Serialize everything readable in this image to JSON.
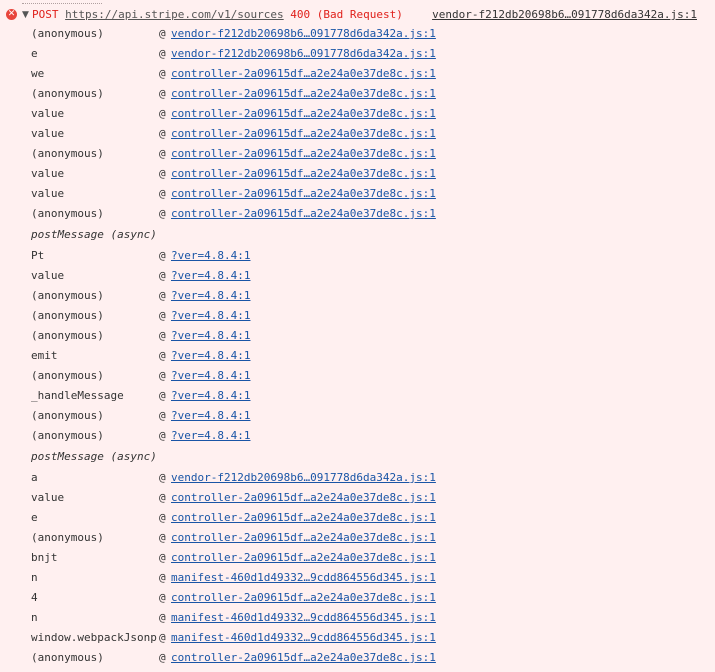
{
  "header": {
    "method": "POST",
    "url": "https://api.stripe.com/v1/sources",
    "status": "400 (Bad Request)",
    "source": "vendor-f212db20698b6…091778d6da342a.js:1"
  },
  "at_symbol": "@",
  "stack": [
    {
      "type": "frame",
      "fn": "(anonymous)",
      "src": "vendor-f212db20698b6…091778d6da342a.js:1"
    },
    {
      "type": "frame",
      "fn": "e",
      "src": "vendor-f212db20698b6…091778d6da342a.js:1"
    },
    {
      "type": "frame",
      "fn": "we",
      "src": "controller-2a09615df…a2e24a0e37de8c.js:1"
    },
    {
      "type": "frame",
      "fn": "(anonymous)",
      "src": "controller-2a09615df…a2e24a0e37de8c.js:1"
    },
    {
      "type": "frame",
      "fn": "value",
      "src": "controller-2a09615df…a2e24a0e37de8c.js:1"
    },
    {
      "type": "frame",
      "fn": "value",
      "src": "controller-2a09615df…a2e24a0e37de8c.js:1"
    },
    {
      "type": "frame",
      "fn": "(anonymous)",
      "src": "controller-2a09615df…a2e24a0e37de8c.js:1"
    },
    {
      "type": "frame",
      "fn": "value",
      "src": "controller-2a09615df…a2e24a0e37de8c.js:1"
    },
    {
      "type": "frame",
      "fn": "value",
      "src": "controller-2a09615df…a2e24a0e37de8c.js:1"
    },
    {
      "type": "frame",
      "fn": "(anonymous)",
      "src": "controller-2a09615df…a2e24a0e37de8c.js:1"
    },
    {
      "type": "async",
      "label": "postMessage (async)"
    },
    {
      "type": "frame",
      "fn": "Pt",
      "src": "?ver=4.8.4:1"
    },
    {
      "type": "frame",
      "fn": "value",
      "src": "?ver=4.8.4:1"
    },
    {
      "type": "frame",
      "fn": "(anonymous)",
      "src": "?ver=4.8.4:1"
    },
    {
      "type": "frame",
      "fn": "(anonymous)",
      "src": "?ver=4.8.4:1"
    },
    {
      "type": "frame",
      "fn": "(anonymous)",
      "src": "?ver=4.8.4:1"
    },
    {
      "type": "frame",
      "fn": "emit",
      "src": "?ver=4.8.4:1"
    },
    {
      "type": "frame",
      "fn": "(anonymous)",
      "src": "?ver=4.8.4:1"
    },
    {
      "type": "frame",
      "fn": "_handleMessage",
      "src": "?ver=4.8.4:1"
    },
    {
      "type": "frame",
      "fn": "(anonymous)",
      "src": "?ver=4.8.4:1"
    },
    {
      "type": "frame",
      "fn": "(anonymous)",
      "src": "?ver=4.8.4:1"
    },
    {
      "type": "async",
      "label": "postMessage (async)"
    },
    {
      "type": "frame",
      "fn": "a",
      "src": "vendor-f212db20698b6…091778d6da342a.js:1"
    },
    {
      "type": "frame",
      "fn": "value",
      "src": "controller-2a09615df…a2e24a0e37de8c.js:1"
    },
    {
      "type": "frame",
      "fn": "e",
      "src": "controller-2a09615df…a2e24a0e37de8c.js:1"
    },
    {
      "type": "frame",
      "fn": "(anonymous)",
      "src": "controller-2a09615df…a2e24a0e37de8c.js:1"
    },
    {
      "type": "frame",
      "fn": "bnjt",
      "src": "controller-2a09615df…a2e24a0e37de8c.js:1"
    },
    {
      "type": "frame",
      "fn": "n",
      "src": "manifest-460d1d49332…9cdd864556d345.js:1"
    },
    {
      "type": "frame",
      "fn": "4",
      "src": "controller-2a09615df…a2e24a0e37de8c.js:1"
    },
    {
      "type": "frame",
      "fn": "n",
      "src": "manifest-460d1d49332…9cdd864556d345.js:1"
    },
    {
      "type": "frame",
      "fn": "window.webpackJsonp",
      "src": "manifest-460d1d49332…9cdd864556d345.js:1"
    },
    {
      "type": "frame",
      "fn": "(anonymous)",
      "src": "controller-2a09615df…a2e24a0e37de8c.js:1"
    }
  ],
  "colors": {
    "background": "#fff0f0",
    "error": "#e0201b",
    "link": "#1a55a6"
  }
}
